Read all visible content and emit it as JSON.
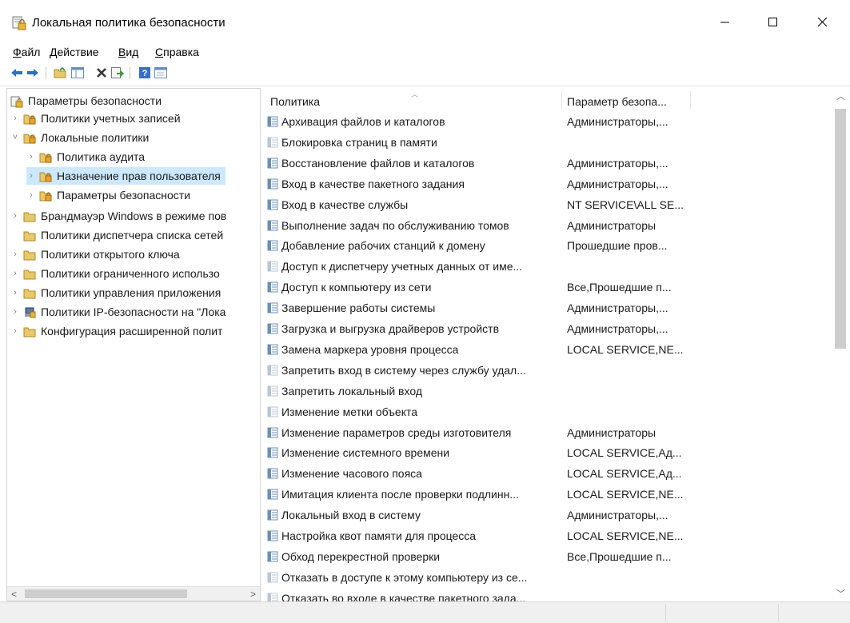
{
  "window": {
    "title": "Локальная политика безопасности",
    "minimize_icon": "minimize-icon",
    "maximize_icon": "maximize-icon",
    "close_icon": "close-icon"
  },
  "menu": [
    "Файл",
    "Действие",
    "Вид",
    "Справка"
  ],
  "toolbar": [
    "back-arrow-icon",
    "forward-arrow-icon",
    "up-folder-icon",
    "show-hide-tree-icon",
    "delete-icon",
    "export-list-icon",
    "help-icon",
    "properties-icon"
  ],
  "tree": {
    "root": "Параметры безопасности",
    "items": [
      {
        "label": "Политики учетных записей",
        "chevron": "›"
      },
      {
        "label": "Локальные политики",
        "chevron": "˅"
      },
      {
        "label": "Политика аудита",
        "chevron": "›"
      },
      {
        "label": "Назначение прав пользователя",
        "chevron": "›"
      },
      {
        "label": "Параметры безопасности",
        "chevron": "›"
      },
      {
        "label": "Брандмауэр Windows в режиме пов",
        "chevron": "›"
      },
      {
        "label": "Политики диспетчера списка сетей",
        "chevron": ""
      },
      {
        "label": "Политики открытого ключа",
        "chevron": "›"
      },
      {
        "label": "Политики ограниченного использо",
        "chevron": "›"
      },
      {
        "label": "Политики управления приложения",
        "chevron": "›"
      },
      {
        "label": "Политики IP-безопасности на \"Лока",
        "chevron": "›"
      },
      {
        "label": "Конфигурация расширенной полит",
        "chevron": "›"
      }
    ]
  },
  "list": {
    "columns": [
      "Политика",
      "Параметр безопа..."
    ],
    "rows": [
      {
        "name": "Архивация файлов и каталогов",
        "value": "Администраторы,..."
      },
      {
        "name": "Блокировка страниц в памяти",
        "value": ""
      },
      {
        "name": "Восстановление файлов и каталогов",
        "value": "Администраторы,..."
      },
      {
        "name": "Вход в качестве пакетного задания",
        "value": "Администраторы,..."
      },
      {
        "name": "Вход в качестве службы",
        "value": "NT SERVICE\\ALL SE..."
      },
      {
        "name": "Выполнение задач по обслуживанию томов",
        "value": "Администраторы"
      },
      {
        "name": "Добавление рабочих станций к домену",
        "value": "Прошедшие пров..."
      },
      {
        "name": "Доступ к диспетчеру учетных данных от име...",
        "value": ""
      },
      {
        "name": "Доступ к компьютеру из сети",
        "value": "Все,Прошедшие п..."
      },
      {
        "name": "Завершение работы системы",
        "value": "Администраторы,..."
      },
      {
        "name": "Загрузка и выгрузка драйверов устройств",
        "value": "Администраторы,..."
      },
      {
        "name": "Замена маркера уровня процесса",
        "value": "LOCAL SERVICE,NE..."
      },
      {
        "name": "Запретить вход в систему через службу удал...",
        "value": ""
      },
      {
        "name": "Запретить локальный вход",
        "value": ""
      },
      {
        "name": "Изменение метки объекта",
        "value": ""
      },
      {
        "name": "Изменение параметров среды изготовителя",
        "value": "Администраторы"
      },
      {
        "name": "Изменение системного времени",
        "value": "LOCAL SERVICE,Ад..."
      },
      {
        "name": "Изменение часового пояса",
        "value": "LOCAL SERVICE,Ад..."
      },
      {
        "name": "Имитация клиента после проверки подлинн...",
        "value": "LOCAL SERVICE,NE..."
      },
      {
        "name": "Локальный вход в систему",
        "value": "Администраторы,..."
      },
      {
        "name": "Настройка квот памяти для процесса",
        "value": "LOCAL SERVICE,NE..."
      },
      {
        "name": "Обход перекрестной проверки",
        "value": "Все,Прошедшие п..."
      },
      {
        "name": "Отказать в доступе к этому компьютеру из се...",
        "value": ""
      },
      {
        "name": "Отказать во входе в качестве пакетного зада...",
        "value": ""
      }
    ]
  },
  "scrollbars": {
    "left": "scroll-left-icon",
    "right": "scroll-right-icon",
    "up": "scroll-up-icon",
    "down": "scroll-down-icon"
  },
  "colors": {
    "selection": "#cce8ff",
    "folder": "#e8c86a",
    "policy_icon_set": "#6b8fb5",
    "policy_icon_unset": "#b8c6d4"
  }
}
